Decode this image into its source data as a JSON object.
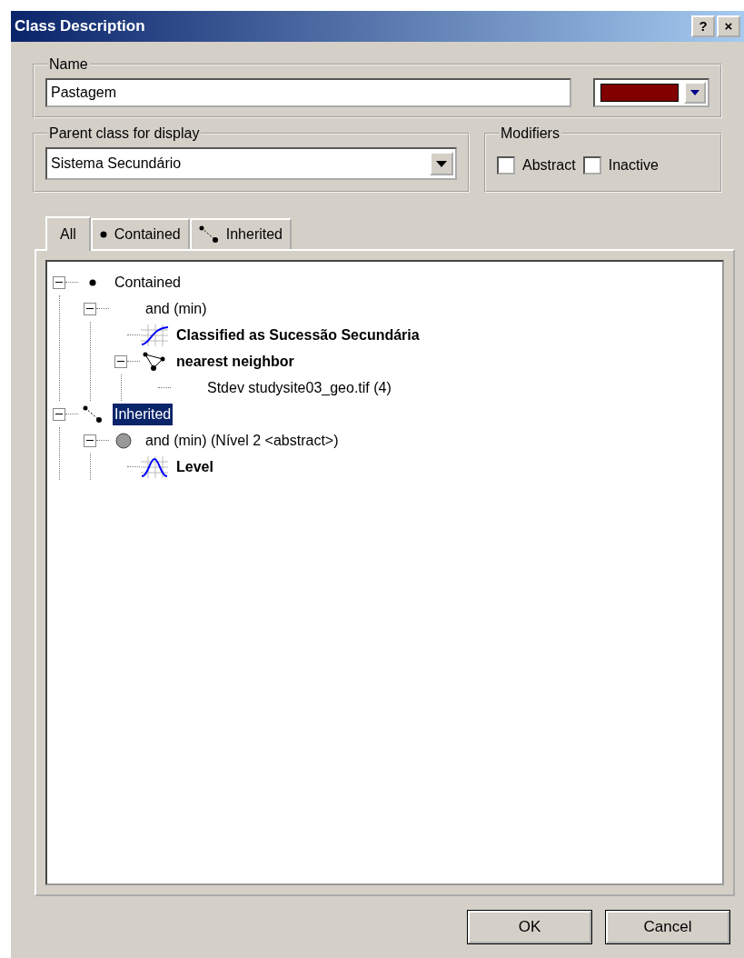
{
  "window": {
    "title": "Class Description",
    "buttons": [
      "?",
      "×"
    ]
  },
  "name_group": {
    "label": "Name",
    "value": "Pastagem",
    "color": "#800000"
  },
  "parent_group": {
    "label": "Parent class for display",
    "value": "Sistema Secundário"
  },
  "modifiers": {
    "label": "Modifiers",
    "options": [
      {
        "label": "Abstract",
        "checked": false
      },
      {
        "label": "Inactive",
        "checked": false
      }
    ]
  },
  "tabs": [
    {
      "label": "All",
      "kind": "plain",
      "selected": true
    },
    {
      "label": "Contained",
      "kind": "dot",
      "selected": false
    },
    {
      "label": "Inherited",
      "kind": "inherit",
      "selected": false
    }
  ],
  "tree": [
    {
      "label": "Contained",
      "kind": "dot",
      "bold": false,
      "selected": false,
      "expanded": true,
      "children": [
        {
          "label": "and (min)",
          "kind": "plain",
          "bold": false,
          "selected": false,
          "expanded": true,
          "children": [
            {
              "label": "Classified as Sucessão Secundária",
              "kind": "curve",
              "bold": true,
              "selected": false
            },
            {
              "label": "nearest neighbor",
              "kind": "neighbor",
              "bold": true,
              "selected": false,
              "expanded": true,
              "children": [
                {
                  "label": "Stdev studysite03_geo.tif (4)",
                  "kind": "plain",
                  "bold": false,
                  "selected": false
                }
              ]
            }
          ]
        }
      ]
    },
    {
      "label": "Inherited",
      "kind": "inherit",
      "bold": false,
      "selected": true,
      "expanded": true,
      "children": [
        {
          "label": "and (min) (Nível 2 <abstract>)",
          "kind": "circle",
          "bold": false,
          "selected": false,
          "expanded": true,
          "children": [
            {
              "label": "Level",
              "kind": "bell",
              "bold": true,
              "selected": false
            }
          ]
        }
      ]
    }
  ],
  "buttons": [
    "OK",
    "Cancel"
  ]
}
